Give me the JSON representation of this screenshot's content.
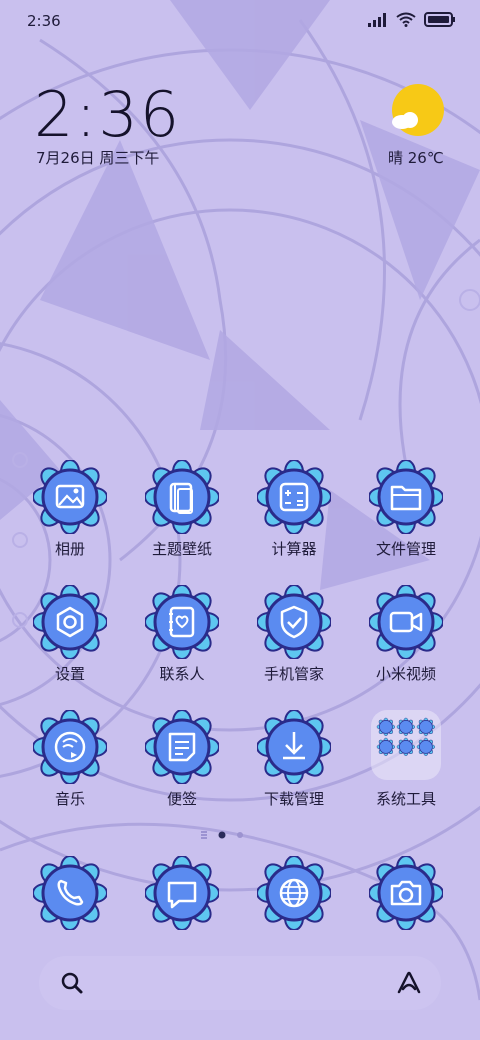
{
  "status_bar": {
    "time": "2:36"
  },
  "lock": {
    "time": "2:36",
    "date": "7月26日 周三下午"
  },
  "weather": {
    "text": "晴 26℃",
    "icon": "sunny-cloud-icon"
  },
  "apps": [
    {
      "label": "相册",
      "icon": "gallery-icon"
    },
    {
      "label": "主题壁纸",
      "icon": "themes-icon"
    },
    {
      "label": "计算器",
      "icon": "calculator-icon"
    },
    {
      "label": "文件管理",
      "icon": "folder-icon"
    },
    {
      "label": "设置",
      "icon": "settings-icon"
    },
    {
      "label": "联系人",
      "icon": "contacts-icon"
    },
    {
      "label": "手机管家",
      "icon": "security-icon"
    },
    {
      "label": "小米视频",
      "icon": "video-icon"
    },
    {
      "label": "音乐",
      "icon": "music-icon"
    },
    {
      "label": "便签",
      "icon": "notes-icon"
    },
    {
      "label": "下载管理",
      "icon": "download-icon"
    },
    {
      "label": "系统工具",
      "icon": "folder-group-icon"
    }
  ],
  "dock": [
    {
      "icon": "phone-icon"
    },
    {
      "icon": "messages-icon"
    },
    {
      "icon": "browser-icon"
    },
    {
      "icon": "camera-icon"
    }
  ],
  "colors": {
    "background": "#c9c0ee",
    "icon_blue": "#5b8bf0",
    "icon_petal": "#5ec7f0",
    "icon_dark": "#2a2b8a",
    "sun": "#f7c916"
  }
}
